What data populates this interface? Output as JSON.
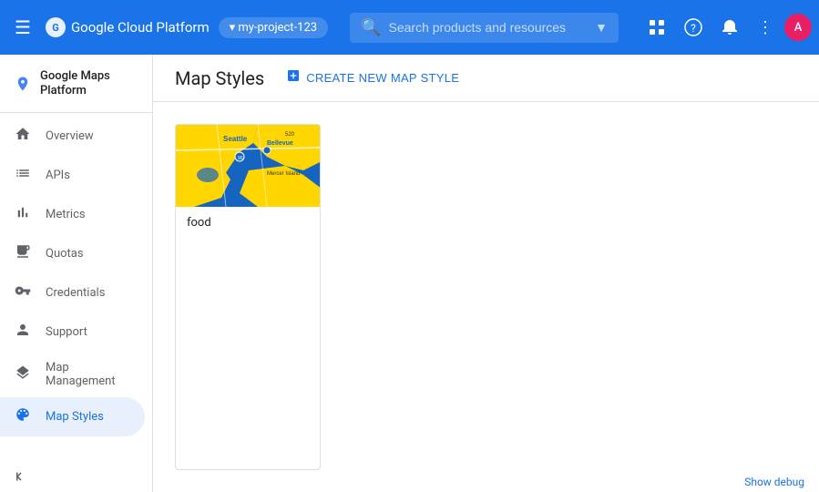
{
  "topbar": {
    "menu_icon": "☰",
    "title": "Google Cloud Platform",
    "account": "cloud-account",
    "search_placeholder": "Search products and resources",
    "icons": {
      "apps": "⊞",
      "help": "?",
      "notifications": "🔔",
      "more": "⋮"
    },
    "avatar_initials": "A"
  },
  "sidebar": {
    "brand": "Google Maps Platform",
    "items": [
      {
        "id": "overview",
        "label": "Overview",
        "icon": "home"
      },
      {
        "id": "apis",
        "label": "APIs",
        "icon": "list"
      },
      {
        "id": "metrics",
        "label": "Metrics",
        "icon": "bar_chart"
      },
      {
        "id": "quotas",
        "label": "Quotas",
        "icon": "monitor"
      },
      {
        "id": "credentials",
        "label": "Credentials",
        "icon": "vpn_key"
      },
      {
        "id": "support",
        "label": "Support",
        "icon": "person"
      },
      {
        "id": "map-management",
        "label": "Map Management",
        "icon": "layers"
      },
      {
        "id": "map-styles",
        "label": "Map Styles",
        "icon": "palette",
        "active": true
      }
    ]
  },
  "page": {
    "title": "Map Styles",
    "create_button": "CREATE NEW MAP STYLE"
  },
  "map_styles": [
    {
      "id": "food",
      "name": "food",
      "preview_type": "seattle"
    }
  ],
  "bottom": {
    "debug_label": "Show debug"
  }
}
